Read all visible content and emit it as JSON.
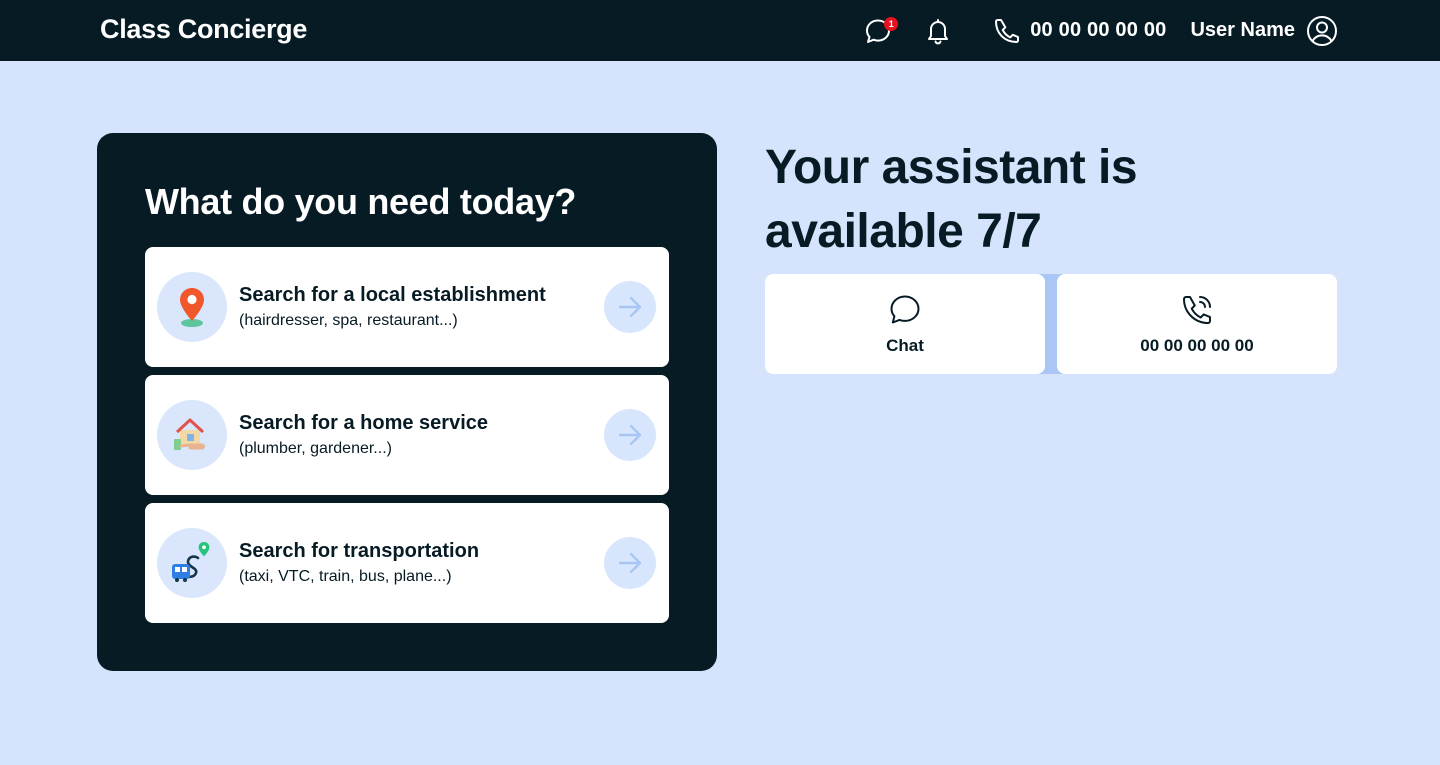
{
  "header": {
    "brand": "Class Concierge",
    "notification_count": "1",
    "phone": "00 00 00 00 00",
    "user_name": "User Name"
  },
  "panel": {
    "title": "What do you need today?",
    "options": [
      {
        "title": "Search for a local establishment",
        "subtitle": "(hairdresser, spa, restaurant...)",
        "icon": "location-pin-icon"
      },
      {
        "title": "Search for a home service",
        "subtitle": "(plumber, gardener...)",
        "icon": "home-service-icon"
      },
      {
        "title": "Search for transportation",
        "subtitle": "(taxi, VTC, train, bus, plane...)",
        "icon": "transport-icon"
      }
    ]
  },
  "assistant": {
    "headline_line1": "Your assistant is",
    "headline_line2": "available 7/7",
    "chat_label": "Chat",
    "phone_label": "00 00 00 00 00"
  },
  "colors": {
    "dark": "#071b25",
    "background": "#d5e4fc",
    "badge": "#e5121f",
    "arrow_circle": "#d8e6fd",
    "arrow": "#a9c6f3"
  }
}
